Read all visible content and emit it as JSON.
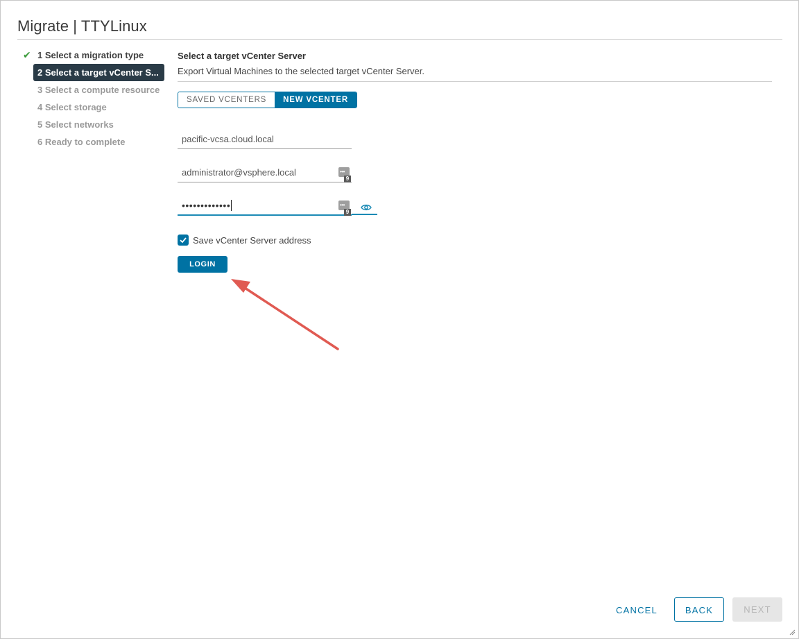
{
  "dialog": {
    "title": "Migrate | TTYLinux"
  },
  "steps": [
    {
      "label": "1 Select a migration type",
      "state": "done"
    },
    {
      "label": "2 Select a target vCenter S...",
      "state": "active"
    },
    {
      "label": "3 Select a compute resource",
      "state": "pending"
    },
    {
      "label": "4 Select storage",
      "state": "pending"
    },
    {
      "label": "5 Select networks",
      "state": "pending"
    },
    {
      "label": "6 Ready to complete",
      "state": "pending"
    }
  ],
  "section": {
    "title": "Select a target vCenter Server",
    "description": "Export Virtual Machines to the selected target vCenter Server."
  },
  "tabs": {
    "saved": "SAVED VCENTERS",
    "new": "NEW VCENTER",
    "selected": "NEW VCENTER"
  },
  "form": {
    "server": "pacific-vcsa.cloud.local",
    "username": "administrator@vsphere.local",
    "password_mask": "•••••••••••••",
    "password_manager_badge": "9",
    "save_address_label": "Save vCenter Server address",
    "save_address_checked": true,
    "login_label": "LOGIN"
  },
  "footer": {
    "cancel": "CANCEL",
    "back": "BACK",
    "next": "NEXT"
  },
  "colors": {
    "primary": "#0072a3",
    "active_step_bg": "#2a3b47",
    "check_green": "#3a9b3a",
    "annotation_arrow": "#e05a52"
  }
}
